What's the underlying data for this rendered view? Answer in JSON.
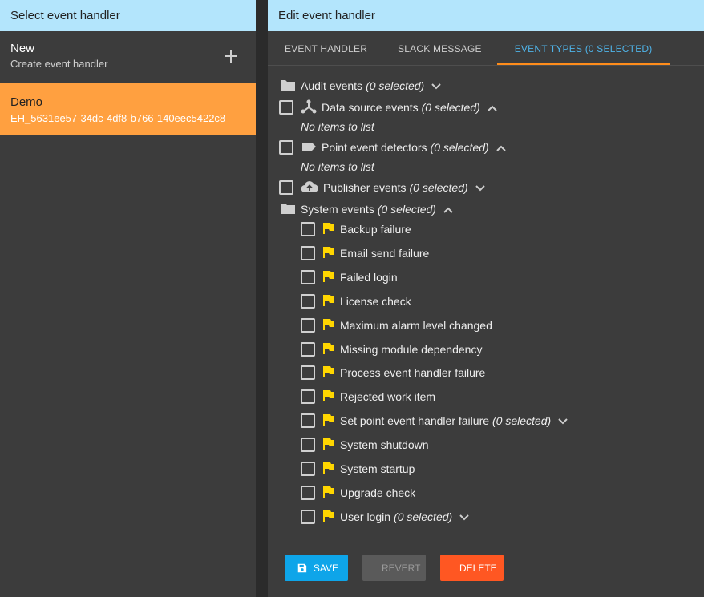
{
  "left": {
    "header": "Select event handler",
    "new_item": {
      "title": "New",
      "subtitle": "Create event handler"
    },
    "selected_item": {
      "title": "Demo",
      "subtitle": "EH_5631ee57-34dc-4df8-b766-140eec5422c8"
    }
  },
  "right": {
    "header": "Edit event handler",
    "tabs": [
      "EVENT HANDLER",
      "SLACK MESSAGE",
      "EVENT TYPES (0 SELECTED)"
    ],
    "groups": {
      "audit": {
        "label": "Audit events",
        "count": "(0 selected)"
      },
      "data_source": {
        "label": "Data source events",
        "count": "(0 selected)",
        "empty": "No items to list"
      },
      "point_detectors": {
        "label": "Point event detectors",
        "count": "(0 selected)",
        "empty": "No items to list"
      },
      "publisher": {
        "label": "Publisher events",
        "count": "(0 selected)"
      },
      "system": {
        "label": "System events",
        "count": "(0 selected)"
      }
    },
    "system_items": [
      {
        "label": "Backup failure"
      },
      {
        "label": "Email send failure"
      },
      {
        "label": "Failed login"
      },
      {
        "label": "License check"
      },
      {
        "label": "Maximum alarm level changed"
      },
      {
        "label": "Missing module dependency"
      },
      {
        "label": "Process event handler failure"
      },
      {
        "label": "Rejected work item"
      },
      {
        "label": "Set point event handler failure",
        "count": "(0 selected)"
      },
      {
        "label": "System shutdown"
      },
      {
        "label": "System startup"
      },
      {
        "label": "Upgrade check"
      },
      {
        "label": "User login",
        "count": "(0 selected)"
      }
    ],
    "buttons": {
      "save": "SAVE",
      "revert": "REVERT",
      "delete": "DELETE"
    }
  },
  "colors": {
    "header_bg": "#b3e5fc",
    "selected_bg": "#ffa040",
    "tab_active": "#4fb3e8",
    "tab_indicator": "#ff8c1a",
    "flag": "#ffd600",
    "save": "#0ea5e9",
    "delete": "#ff5722"
  },
  "icons": {
    "audit": "folder-icon",
    "data_source": "hub-icon",
    "point_detectors": "label-icon",
    "publisher": "cloud-upload-icon",
    "system": "folder-icon",
    "system_item": "flag-icon"
  }
}
